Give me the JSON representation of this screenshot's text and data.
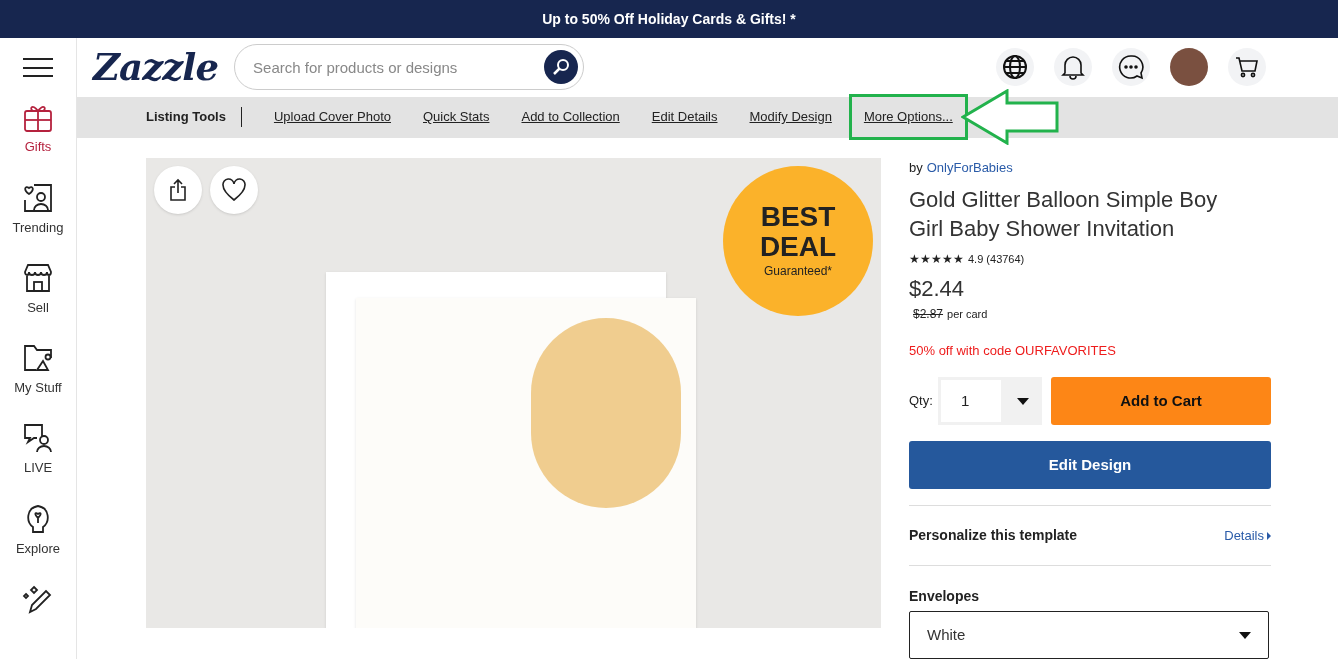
{
  "promo_banner": "Up to 50% Off Holiday Cards & Gifts! *",
  "header": {
    "logo": "Zazzle",
    "search": {
      "placeholder": "Search for products or designs"
    }
  },
  "sidebar": {
    "items": [
      {
        "label": "Gifts",
        "selected": true
      },
      {
        "label": "Trending",
        "selected": false
      },
      {
        "label": "Sell",
        "selected": false
      },
      {
        "label": "My Stuff",
        "selected": false
      },
      {
        "label": "LIVE",
        "selected": false
      },
      {
        "label": "Explore",
        "selected": false
      },
      {
        "selected": false
      }
    ]
  },
  "listing_tools": {
    "title": "Listing Tools",
    "links": [
      {
        "label": "Upload Cover Photo",
        "highlighted": false
      },
      {
        "label": "Quick Stats",
        "highlighted": false
      },
      {
        "label": "Add to Collection",
        "highlighted": false
      },
      {
        "label": "Edit Details",
        "highlighted": false
      },
      {
        "label": "Modify Design",
        "highlighted": false
      },
      {
        "label": "More Options...",
        "highlighted": true
      }
    ]
  },
  "product_image": {
    "badge": {
      "line_1": "BEST",
      "line_2": "DEAL",
      "line_3": "Guaranteed*"
    }
  },
  "product": {
    "by": "by",
    "designer": "OnlyForBabies",
    "title": "Gold Glitter Balloon Simple Boy Girl Baby Shower Invitation",
    "stars": 5,
    "rating": "4.9 (43764)",
    "price": "$2.44",
    "old_price": "$2.87",
    "unit": "per card",
    "promo": "50% off with code OURFAVORITES",
    "qty_label": "Qty:",
    "qty": "1",
    "add_to_cart": "Add to Cart",
    "edit_design": "Edit Design",
    "personalize": "Personalize this template",
    "details": "Details",
    "envelopes_label": "Envelopes",
    "envelopes_value": "White"
  }
}
